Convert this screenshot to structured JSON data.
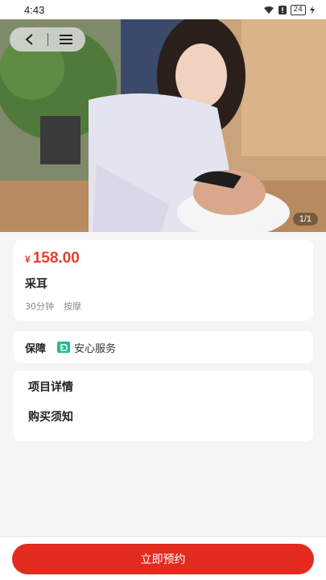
{
  "status_bar": {
    "time": "4:43",
    "battery": "24"
  },
  "gallery": {
    "counter": "1/1"
  },
  "product": {
    "currency": "¥",
    "price": "158.00",
    "name": "采耳",
    "duration": "30分钟",
    "category": "按摩"
  },
  "guarantee": {
    "label": "保障",
    "badge_text": "安心服务",
    "badge_color": "#1fbf8f"
  },
  "info_sections": [
    {
      "label": "项目详情"
    },
    {
      "label": "购买须知"
    }
  ],
  "actions": {
    "book_label": "立即预约"
  },
  "colors": {
    "accent": "#e32b1f",
    "price": "#e8402c",
    "background": "#f5f5f5"
  },
  "icons": [
    "wifi-icon",
    "alert-icon",
    "battery-icon",
    "charging-icon",
    "back-arrow-icon",
    "menu-icon",
    "shield-check-icon"
  ]
}
